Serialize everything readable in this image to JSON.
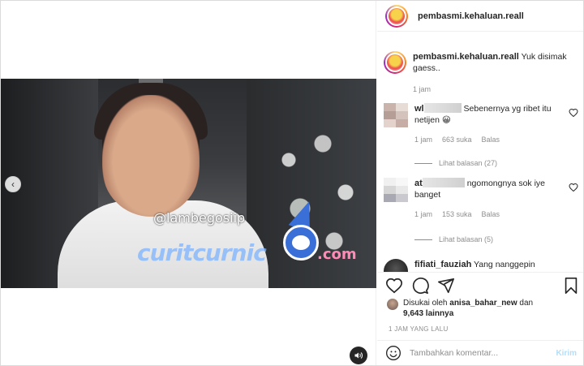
{
  "post": {
    "username": "pembasmi.kehaluan.reall"
  },
  "caption": {
    "username": "pembasmi.kehaluan.reall",
    "text": "Yuk disimak gaess..",
    "time": "1 jam"
  },
  "video": {
    "watermark": "@lambegosiip",
    "brand": "curitcurnic",
    "brand_suffix": ".com"
  },
  "comments": [
    {
      "username_prefix": "wl",
      "text": "Sebenernya yg ribet itu netijen 😀",
      "time": "1 jam",
      "likes": "663 suka",
      "reply": "Balas",
      "view_replies": "Lihat balasan (27)"
    },
    {
      "username_prefix": "at",
      "text": "ngomongnya sok iye banget",
      "time": "1 jam",
      "likes": "153 suka",
      "reply": "Balas",
      "view_replies": "Lihat balasan (5)"
    },
    {
      "username": "fifiati_fauziah",
      "text": "Yang nanggepin"
    }
  ],
  "likes": {
    "prefix": "Disukai oleh",
    "user": "anisa_bahar_new",
    "and": "dan",
    "others": "9,643 lainnya"
  },
  "post_time": "1 JAM YANG LALU",
  "add_comment": {
    "placeholder": "Tambahkan komentar...",
    "send": "Kirim"
  },
  "icons": [
    "chevron-left-icon",
    "speaker-icon",
    "heart-icon",
    "comment-icon",
    "share-icon",
    "bookmark-icon",
    "emoji-icon"
  ]
}
